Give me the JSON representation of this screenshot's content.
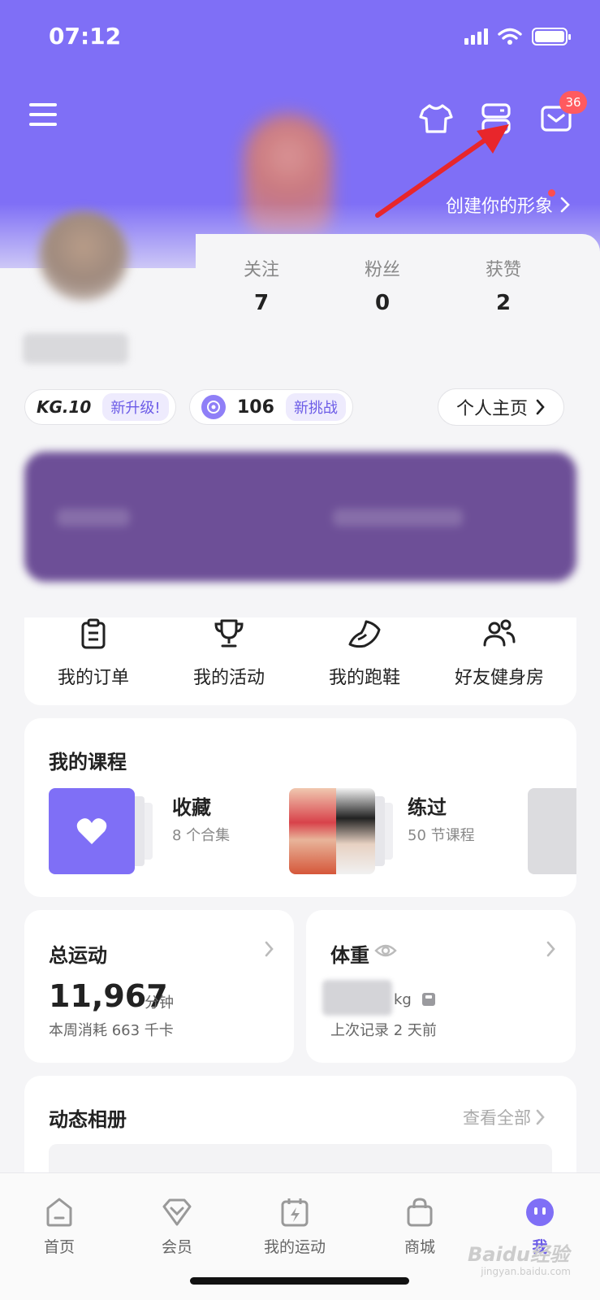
{
  "status": {
    "time": "07:12"
  },
  "header": {
    "create_link": "创建你的形象",
    "mail_badge": "36"
  },
  "stats": [
    {
      "label": "关注",
      "value": "7"
    },
    {
      "label": "粉丝",
      "value": "0"
    },
    {
      "label": "获赞",
      "value": "2"
    }
  ],
  "badges": {
    "level": "KG.10",
    "level_tag": "新升级!",
    "points": "106",
    "points_tag": "新挑战",
    "profile_button": "个人主页"
  },
  "quick_actions": [
    {
      "label": "我的订单",
      "icon": "clipboard-icon"
    },
    {
      "label": "我的活动",
      "icon": "trophy-icon"
    },
    {
      "label": "我的跑鞋",
      "icon": "shoe-icon"
    },
    {
      "label": "好友健身房",
      "icon": "friends-icon"
    }
  ],
  "courses": {
    "title": "我的课程",
    "items": [
      {
        "title": "收藏",
        "subtitle": "8 个合集"
      },
      {
        "title": "练过",
        "subtitle": "50 节课程"
      }
    ]
  },
  "motion": {
    "title": "总运动",
    "value": "11,967",
    "unit": "分钟",
    "subtitle": "本周消耗 663 千卡"
  },
  "weight": {
    "title": "体重",
    "unit": "kg",
    "subtitle": "上次记录 2 天前"
  },
  "album": {
    "title": "动态相册",
    "link": "查看全部"
  },
  "tabs": [
    {
      "label": "首页",
      "icon": "home-icon"
    },
    {
      "label": "会员",
      "icon": "member-icon"
    },
    {
      "label": "我的运动",
      "icon": "calendar-bolt-icon"
    },
    {
      "label": "商城",
      "icon": "bag-icon"
    },
    {
      "label": "我",
      "icon": "me-face-icon",
      "active": true
    }
  ],
  "watermark": {
    "brand": "Baidu经验",
    "url": "jingyan.baidu.com"
  },
  "colors": {
    "accent": "#7f6ff6",
    "badge": "#ff5a5f",
    "arrow": "#e8262b"
  }
}
